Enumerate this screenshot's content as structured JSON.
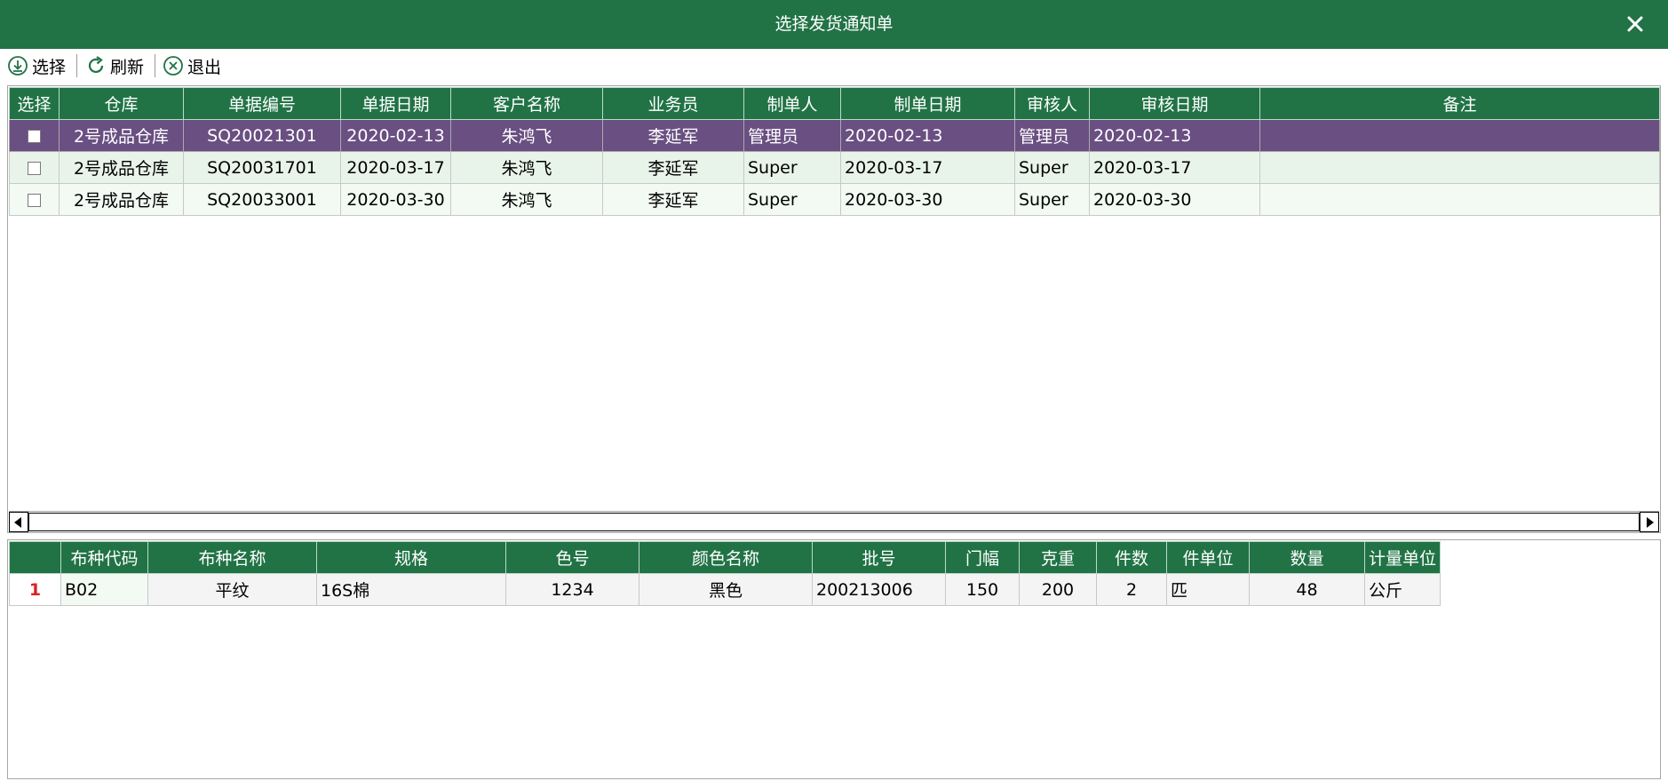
{
  "window": {
    "title": "选择发货通知单"
  },
  "toolbar": {
    "select_label": "选择",
    "refresh_label": "刷新",
    "exit_label": "退出"
  },
  "top_table": {
    "headers": [
      "选择",
      "仓库",
      "单据编号",
      "单据日期",
      "客户名称",
      "业务员",
      "制单人",
      "制单日期",
      "审核人",
      "审核日期",
      "备注"
    ],
    "rows": [
      [
        "",
        "2号成品仓库",
        "SQ20021301",
        "2020-02-13",
        "朱鸿飞",
        "李延军",
        "管理员",
        "2020-02-13",
        "管理员",
        "2020-02-13",
        ""
      ],
      [
        "",
        "2号成品仓库",
        "SQ20031701",
        "2020-03-17",
        "朱鸿飞",
        "李延军",
        "Super",
        "2020-03-17",
        "Super",
        "2020-03-17",
        ""
      ],
      [
        "",
        "2号成品仓库",
        "SQ20033001",
        "2020-03-30",
        "朱鸿飞",
        "李延军",
        "Super",
        "2020-03-30",
        "Super",
        "2020-03-30",
        ""
      ]
    ],
    "selected_row": 0
  },
  "bottom_table": {
    "headers": [
      "",
      "布种代码",
      "布种名称",
      "规格",
      "色号",
      "颜色名称",
      "批号",
      "门幅",
      "克重",
      "件数",
      "件单位",
      "数量",
      "计量单位"
    ],
    "rows": [
      [
        "1",
        "B02",
        "平纹",
        "16S棉",
        "1234",
        "黑色",
        "200213006",
        "150",
        "200",
        "2",
        "匹",
        "48",
        "公斤"
      ]
    ]
  },
  "colors": {
    "header_green": "#217346",
    "selected_row": "#6a4f82",
    "row_tint": "#e8f4ea"
  }
}
